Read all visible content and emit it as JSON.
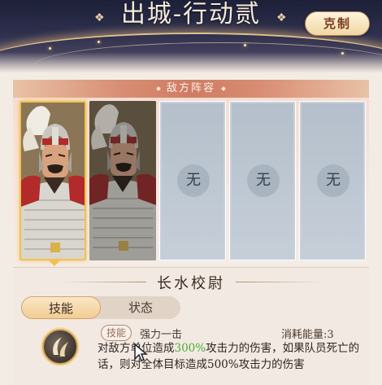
{
  "header": {
    "title": "出城-行动贰",
    "restrain_label": "克制"
  },
  "lineup": {
    "banner": "敌方阵容",
    "slots": [
      {
        "type": "hero",
        "selected": true
      },
      {
        "type": "hero",
        "selected": false
      },
      {
        "type": "empty",
        "label": "无"
      },
      {
        "type": "empty",
        "label": "无"
      },
      {
        "type": "empty",
        "label": "无"
      }
    ]
  },
  "detail": {
    "general_name": "长水校尉",
    "tabs": [
      {
        "label": "技能",
        "active": true
      },
      {
        "label": "状态",
        "active": false
      }
    ],
    "skill": {
      "icon": "skill-slash-icon",
      "tag": "技能",
      "name": "强力一击",
      "cost": "消耗能量:3",
      "desc_pre": "对敌方单位造成",
      "desc_highlight": "300%",
      "desc_post": "攻击力的伤害，如果队员死亡的话，则对全体目标造成500%攻击力的伤害"
    }
  },
  "colors": {
    "highlight": "#4caa34",
    "accent_gold": "#f2c14e",
    "banner": "#d07c64"
  }
}
